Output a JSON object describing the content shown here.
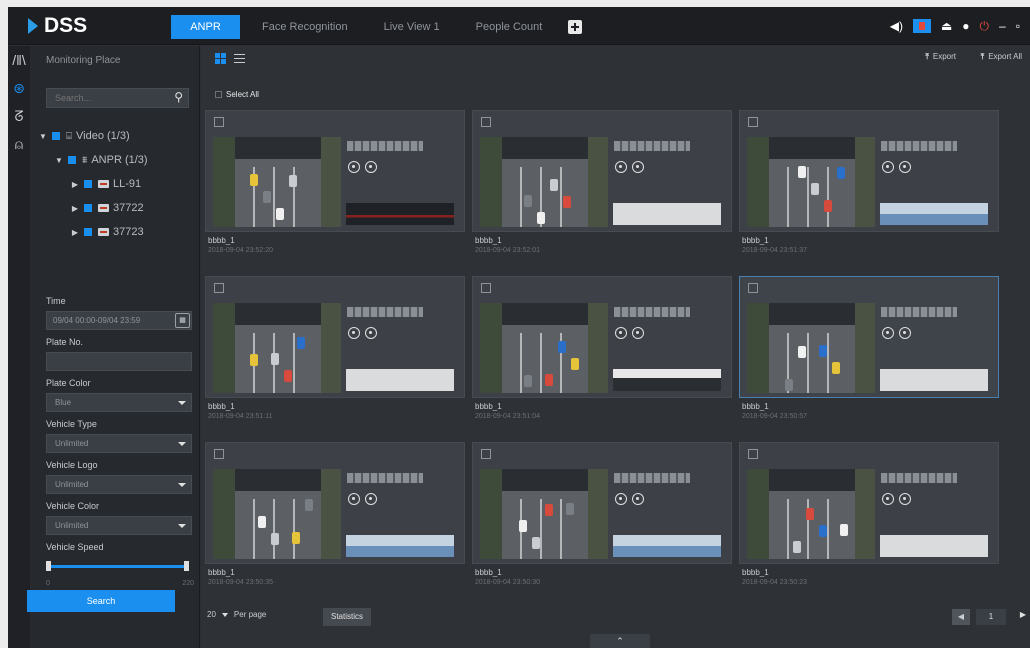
{
  "app": {
    "logo": "DSS"
  },
  "tabs": [
    {
      "label": "ANPR",
      "active": true
    },
    {
      "label": "Face Recognition",
      "active": false
    },
    {
      "label": "Live View 1",
      "active": false
    },
    {
      "label": "People Count",
      "active": false
    }
  ],
  "tray_icons": [
    "speaker-icon",
    "alarm-icon",
    "user-icon",
    "gear-icon",
    "power-icon",
    "minimize-icon",
    "maximize-icon",
    "close-icon"
  ],
  "left_panel": {
    "title": "Monitoring Place",
    "search_placeholder": "Search...",
    "tree": [
      {
        "label": "Video (1/3)",
        "level": 0,
        "expanded": true
      },
      {
        "label": "ANPR (1/3)",
        "level": 1,
        "expanded": true
      },
      {
        "label": "LL-91",
        "level": 2
      },
      {
        "label": "37722",
        "level": 2
      },
      {
        "label": "37723",
        "level": 2
      }
    ]
  },
  "filters": {
    "time_label": "Time",
    "time_value": "09/04 00:00-09/04 23:59",
    "plate_label": "Plate No.",
    "plate_value": "",
    "plate_color_label": "Plate Color",
    "plate_color_value": "Blue",
    "vehicle_type_label": "Vehicle Type",
    "vehicle_type_value": "Unlimited",
    "vehicle_logo_label": "Vehicle Logo",
    "vehicle_logo_value": "Unlimited",
    "vehicle_color_label": "Vehicle Color",
    "vehicle_color_value": "Unlimited",
    "vehicle_speed_label": "Vehicle Speed",
    "speed_min": "0",
    "speed_max": "220",
    "search_button": "Search"
  },
  "toolbar": {
    "export_label": "Export",
    "export_all_label": "Export All",
    "select_all_label": "Select All"
  },
  "captures": [
    {
      "name": "bbbb_1",
      "time": "2018-09-04 23:52:20",
      "plate_style": "ship",
      "selected": false
    },
    {
      "name": "bbbb_1",
      "time": "2018-09-04 23:52:01",
      "plate_style": "light",
      "selected": false
    },
    {
      "name": "bbbb_1",
      "time": "2018-09-04 23:51:37",
      "plate_style": "blue",
      "selected": false
    },
    {
      "name": "bbbb_1",
      "time": "2018-09-04 23:51:11",
      "plate_style": "light",
      "selected": false
    },
    {
      "name": "bbbb_1",
      "time": "2018-09-04 23:51:04",
      "plate_style": "dark",
      "selected": false
    },
    {
      "name": "bbbb_1",
      "time": "2018-09-04 23:50:57",
      "plate_style": "light",
      "selected": true
    },
    {
      "name": "bbbb_1",
      "time": "2018-09-04 23:50:35",
      "plate_style": "blue",
      "selected": false
    },
    {
      "name": "bbbb_1",
      "time": "2018-09-04 23:50:30",
      "plate_style": "blue",
      "selected": false
    },
    {
      "name": "bbbb_1",
      "time": "2018-09-04 23:50:23",
      "plate_style": "light",
      "selected": false
    }
  ],
  "pagination": {
    "per_page_value": "20",
    "per_page_label": "Per page",
    "statistics_button": "Statistics",
    "current_page": "1"
  },
  "colors": {
    "accent": "#1a8ff0",
    "panel": "#26292e",
    "main": "#2e3136",
    "card": "#3d4047"
  }
}
